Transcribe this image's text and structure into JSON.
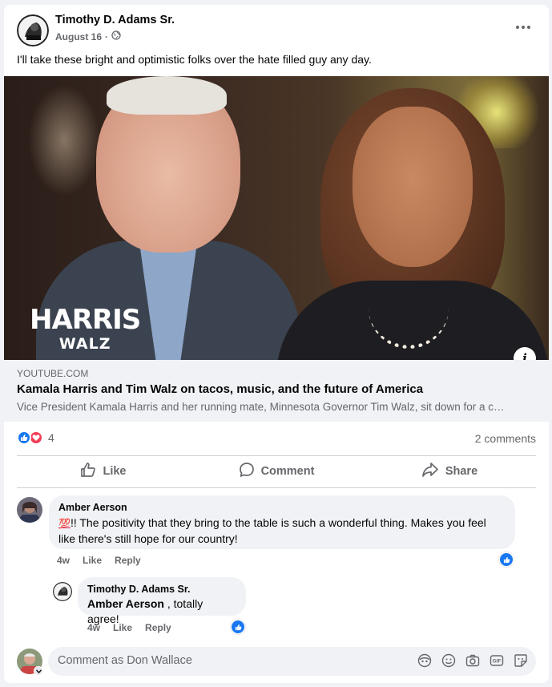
{
  "post": {
    "author": "Timothy D. Adams Sr.",
    "date": "August 16",
    "separator": "·",
    "text": "I'll take these bright and optimistic folks over the hate filled guy any day."
  },
  "link": {
    "domain": "YOUTUBE.COM",
    "title": "Kamala Harris and Tim Walz on tacos, music, and the future of America",
    "description": "Vice President Kamala Harris and her running mate, Minnesota Governor Tim Walz, sit down for a c…",
    "image_logo_line1": "HARRIS",
    "image_logo_line2": "WALZ",
    "info_label": "i"
  },
  "engagement": {
    "reaction_count": "4",
    "comment_count": "2 comments"
  },
  "actions": {
    "like": "Like",
    "comment": "Comment",
    "share": "Share"
  },
  "comments": [
    {
      "author": "Amber Aerson",
      "emoji": "💯",
      "text": "!! The positivity that they bring to the table is such a wonderful thing. Makes you feel like there's still hope for our country!",
      "age": "4w",
      "like_label": "Like",
      "reply_label": "Reply"
    }
  ],
  "reply": {
    "author": "Timothy D. Adams Sr.",
    "mention": "Amber Aerson",
    "text": " , totally agree!",
    "age": "4w",
    "like_label": "Like",
    "reply_label": "Reply"
  },
  "composer": {
    "placeholder": "Comment as Don Wallace"
  },
  "colors": {
    "brand_blue": "#1877f2",
    "love_red": "#f33e58",
    "secondary_text": "#65676b",
    "bubble_bg": "#f0f2f5"
  },
  "icons": [
    "globe-icon",
    "more-icon",
    "info-icon",
    "like-reaction-icon",
    "love-reaction-icon",
    "thumb-up-icon",
    "comment-icon",
    "share-icon",
    "avatar-sticker-icon",
    "emoji-icon",
    "camera-icon",
    "gif-icon",
    "sticker-icon"
  ]
}
